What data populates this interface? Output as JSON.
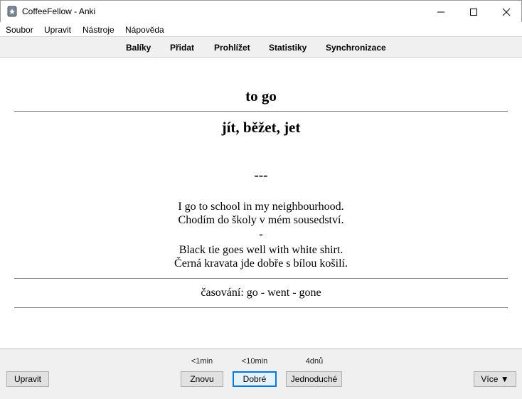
{
  "window": {
    "title": "CoffeeFellow - Anki"
  },
  "menu": [
    "Soubor",
    "Upravit",
    "Nástroje",
    "Nápověda"
  ],
  "toolbar": [
    "Balíky",
    "Přidat",
    "Prohlížet",
    "Statistiky",
    "Synchronizace"
  ],
  "card": {
    "front": "to go",
    "back": "jít, běžet, jet",
    "separator": "---",
    "examples": [
      "I go to school in my neighbourhood.",
      "Chodím do školy v mém sousedství.",
      "-",
      "Black tie goes well with white shirt.",
      "Černá kravata jde dobře s bílou košilí."
    ],
    "conjugation": "časování: go - went - gone"
  },
  "bottom": {
    "edit_label": "Upravit",
    "more_label": "Více ▼",
    "intervals": [
      "<1min",
      "<10min",
      "4dnů"
    ],
    "answers": [
      "Znovu",
      "Dobré",
      "Jednoduché"
    ]
  }
}
